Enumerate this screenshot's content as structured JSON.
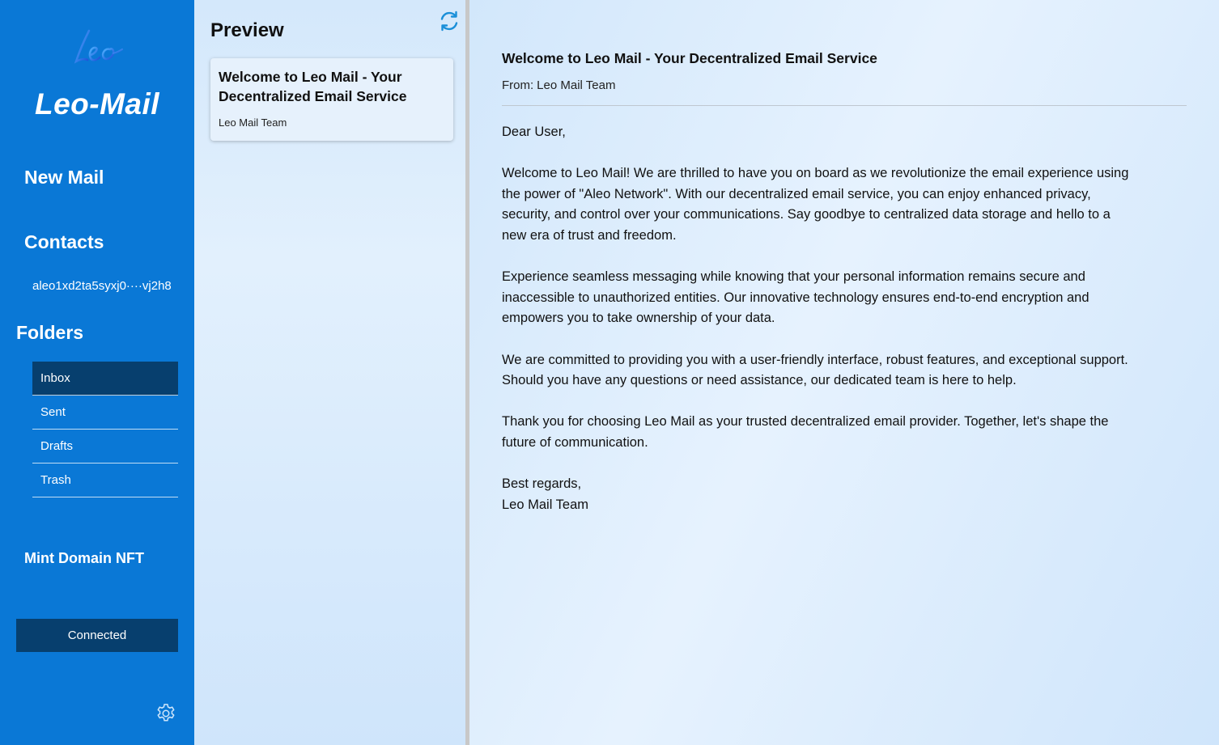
{
  "sidebar": {
    "logo_text": "leo",
    "app_name": "Leo-Mail",
    "new_mail_label": "New Mail",
    "contacts_label": "Contacts",
    "contact_address": "aleo1xd2ta5syxj0····vj2h8",
    "folders_label": "Folders",
    "folders": [
      {
        "label": "Inbox",
        "active": true
      },
      {
        "label": "Sent",
        "active": false
      },
      {
        "label": "Drafts",
        "active": false
      },
      {
        "label": "Trash",
        "active": false
      }
    ],
    "mint_domain_label": "Mint Domain NFT",
    "connect_label": "Connected",
    "settings_icon": "gear-icon"
  },
  "preview": {
    "title": "Preview",
    "refresh_icon": "refresh-icon",
    "mails": [
      {
        "subject": "Welcome to Leo Mail - Your Decentralized Email Service",
        "sender": "Leo Mail Team"
      }
    ]
  },
  "reader": {
    "subject": "Welcome to Leo Mail - Your Decentralized Email Service",
    "from_label": "From:",
    "from": "Leo Mail Team",
    "greeting": "Dear User,",
    "paragraphs": [
      "Welcome to Leo Mail! We are thrilled to have you on board as we revolutionize the email experience using the power of \"Aleo Network\". With our decentralized email service, you can enjoy enhanced privacy, security, and control over your communications. Say goodbye to centralized data storage and hello to a new era of trust and freedom.",
      "Experience seamless messaging while knowing that your personal information remains secure and inaccessible to unauthorized entities. Our innovative technology ensures end-to-end encryption and empowers you to take ownership of your data.",
      "We are committed to providing you with a user-friendly interface, robust features, and exceptional support. Should you have any questions or need assistance, our dedicated team is here to help.",
      "Thank you for choosing Leo Mail as your trusted decentralized email provider. Together, let's shape the future of communication."
    ],
    "closing": "Best regards,",
    "signature": "Leo Mail Team"
  },
  "colors": {
    "sidebar": "#0a78d6",
    "active_folder": "#073f6e",
    "connect_button": "#073f6e",
    "refresh_icon": "#1a8fd8"
  }
}
